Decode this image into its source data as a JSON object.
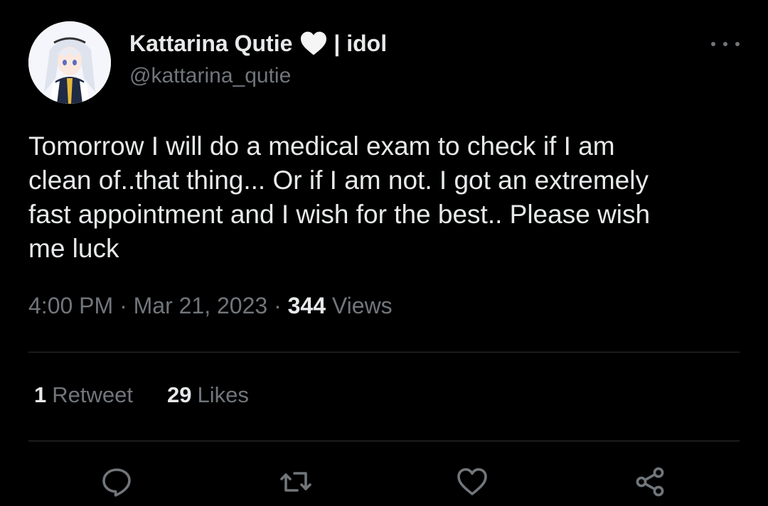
{
  "author": {
    "display_name": "Kattarina Qutie",
    "name_suffix": "| idol",
    "handle": "@kattarina_qutie",
    "avatar_icon": "anime-avatar",
    "heart_icon": "white-heart-icon"
  },
  "tweet": {
    "text": "Tomorrow I will do a medical exam to check if I am\nclean of..that thing... Or if I am not. I got an extremely\nfast appointment and I wish for the best.. Please wish\nme luck",
    "time": "4:00 PM",
    "sep1": "·",
    "date": "Mar 21, 2023",
    "sep2": "·",
    "views_count": "344",
    "views_label": "Views"
  },
  "stats": {
    "retweets_count": "1",
    "retweets_label": "Retweet",
    "likes_count": "29",
    "likes_label": "Likes"
  },
  "actions": [
    {
      "name": "reply",
      "icon": "reply-icon"
    },
    {
      "name": "retweet",
      "icon": "retweet-icon"
    },
    {
      "name": "like",
      "icon": "heart-icon"
    },
    {
      "name": "share",
      "icon": "share-icon"
    }
  ],
  "colors": {
    "background": "#000000",
    "primary_text": "#e7e9ea",
    "secondary_text": "#71767b",
    "divider": "#2f3336"
  }
}
